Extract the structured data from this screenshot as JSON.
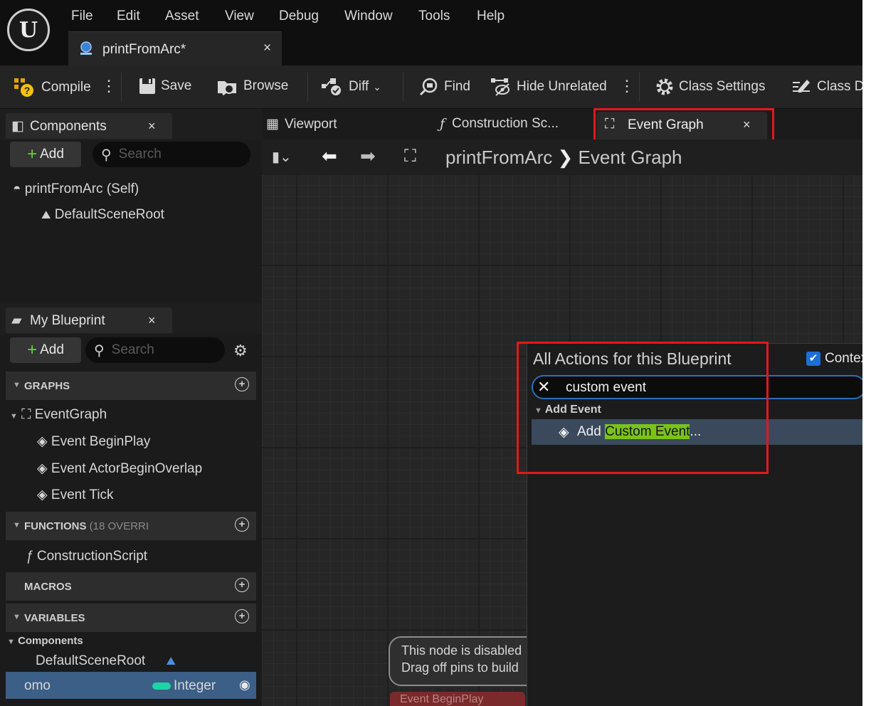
{
  "menu": [
    "File",
    "Edit",
    "Asset",
    "View",
    "Debug",
    "Window",
    "Tools",
    "Help"
  ],
  "document_tab": {
    "title": "printFromArc*",
    "close": "×"
  },
  "toolbar": {
    "compile": "Compile",
    "save": "Save",
    "browse": "Browse",
    "diff": "Diff",
    "find": "Find",
    "hide_unrelated": "Hide Unrelated",
    "class_settings": "Class Settings",
    "class_defaults": "Class D"
  },
  "components_panel": {
    "tab": "Components",
    "close": "×",
    "add": "Add",
    "search_placeholder": "Search",
    "items": [
      "printFromArc (Self)",
      "DefaultSceneRoot"
    ]
  },
  "editor_tabs": [
    {
      "label": "Viewport"
    },
    {
      "label": "Construction Sc..."
    },
    {
      "label": "Event Graph",
      "close": "×"
    }
  ],
  "breadcrumb": {
    "blueprint": "printFromArc",
    "separator": "❯",
    "graph": "Event Graph"
  },
  "my_blueprint": {
    "tab": "My Blueprint",
    "close": "×",
    "add": "Add",
    "search_placeholder": "Search",
    "graphs_header": "GRAPHS",
    "event_graph": "EventGraph",
    "events": [
      "Event BeginPlay",
      "Event ActorBeginOverlap",
      "Event Tick"
    ],
    "functions_header": "FUNCTIONS",
    "functions_note": "(18 OVERRI",
    "construction_script": "ConstructionScript",
    "macros_header": "MACROS",
    "variables_header": "VARIABLES",
    "components_header": "Components",
    "default_scene_root": "DefaultSceneRoot",
    "variable": {
      "name": "omo",
      "type": "Integer",
      "type_color": "#1fd3a4"
    }
  },
  "action_menu": {
    "title": "All Actions for this Blueprint",
    "context_label": "Contex",
    "search_value": "custom event",
    "category": "Add Event",
    "item_prefix": "Add ",
    "item_highlight": "Custom Event",
    "item_suffix": "..."
  },
  "graph_comment": {
    "line1": "This node is disabled",
    "line2": "Drag off pins to build",
    "node": "Event BeginPlay"
  },
  "colors": {
    "highlight": "#7ac31b",
    "selection": "#3a4a5c",
    "annotation": "#e01a1a"
  }
}
